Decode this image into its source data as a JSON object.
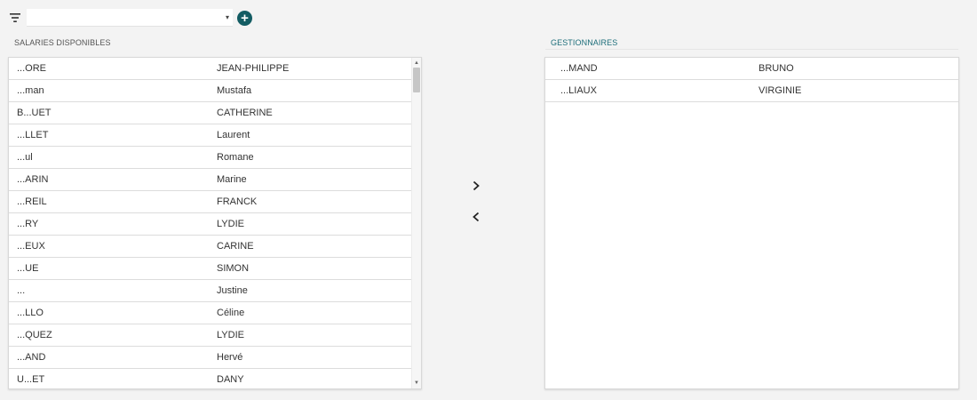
{
  "toolbar": {
    "filter_icon": "filter-icon",
    "select_value": "",
    "select_caret": "▾",
    "add_icon": "plus-circle-icon",
    "add_symbol": "+",
    "accent_color": "#135c63"
  },
  "left_panel": {
    "title": "SALARIES DISPONIBLES",
    "rows": [
      {
        "last": "...ORE",
        "first": "JEAN-PHILIPPE"
      },
      {
        "last": "...man",
        "first": "Mustafa"
      },
      {
        "last": "B...UET",
        "first": "CATHERINE"
      },
      {
        "last": "...LLET",
        "first": "Laurent"
      },
      {
        "last": "...ul",
        "first": "Romane"
      },
      {
        "last": "...ARIN",
        "first": "Marine"
      },
      {
        "last": "...REIL",
        "first": "FRANCK"
      },
      {
        "last": "...RY",
        "first": "LYDIE"
      },
      {
        "last": "...EUX",
        "first": "CARINE"
      },
      {
        "last": "...UE",
        "first": "SIMON"
      },
      {
        "last": "...",
        "first": "Justine"
      },
      {
        "last": "...LLO",
        "first": "Céline"
      },
      {
        "last": "...QUEZ",
        "first": "LYDIE"
      },
      {
        "last": "...AND",
        "first": "Hervé"
      },
      {
        "last": "U...ET",
        "first": "DANY"
      }
    ],
    "scroll_up": "▲",
    "scroll_down": "▼"
  },
  "right_panel": {
    "title": "GESTIONNAIRES",
    "title_color": "#1d6e7a",
    "rows": [
      {
        "last": "...MAND",
        "first": "BRUNO"
      },
      {
        "last": "...LIAUX",
        "first": "VIRGINIE"
      }
    ]
  },
  "transfer": {
    "right_icon": "chevron-right-icon",
    "left_icon": "chevron-left-icon"
  }
}
